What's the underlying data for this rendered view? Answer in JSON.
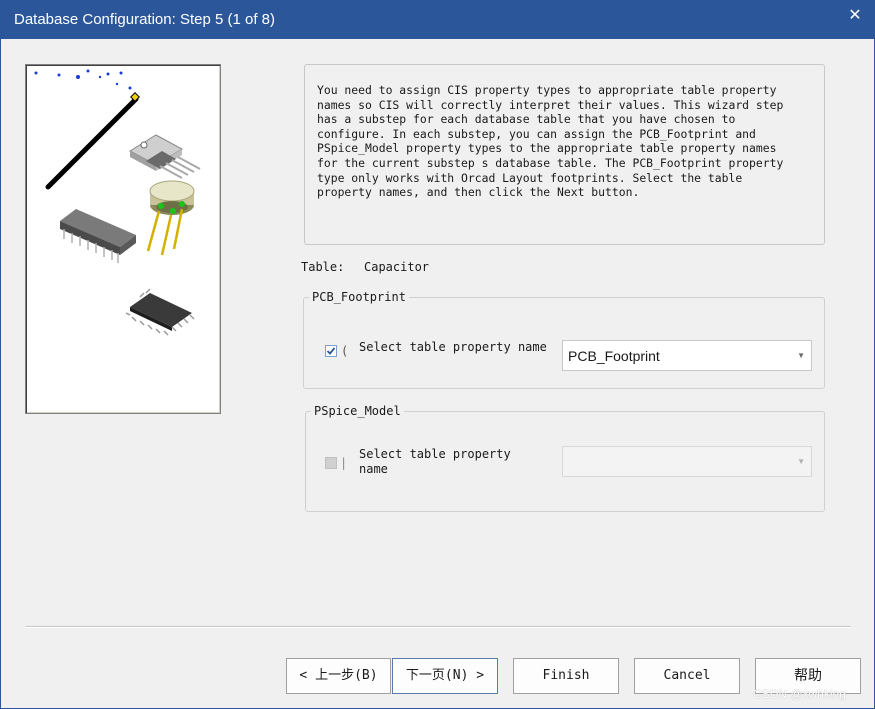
{
  "window": {
    "title": "Database Configuration: Step 5 (1 of 8)",
    "close_glyph": "✕"
  },
  "description": "You need to assign CIS property types to appropriate table property\nnames so CIS will correctly interpret their values. This wizard step\nhas a substep for each database table that you have chosen to\nconfigure. In each substep, you can assign the PCB_Footprint and\nPSpice_Model property types to the appropriate table property names\nfor the current substep s database table. The PCB_Footprint property\ntype only works with Orcad Layout footprints. Select the table\nproperty names, and then click the Next button.",
  "table": {
    "label": "Table:",
    "value": "Capacitor"
  },
  "pcb_footprint_group": {
    "title": "PCB_Footprint",
    "checkbox_checked": true,
    "checkbox_label": "Select table property name",
    "selected": "PCB_Footprint"
  },
  "pspice_model_group": {
    "title": "PSpice_Model",
    "checkbox_checked": false,
    "checkbox_label": "Select table property\nname",
    "selected": ""
  },
  "buttons": {
    "back": "< 上一步(B)",
    "next": "下一页(N) >",
    "finish": "Finish",
    "cancel": "Cancel",
    "help": "帮助"
  },
  "watermark": "CSDN @xwhking",
  "colors": {
    "titlebar": "#2b579a",
    "background": "#f0f0f0"
  }
}
